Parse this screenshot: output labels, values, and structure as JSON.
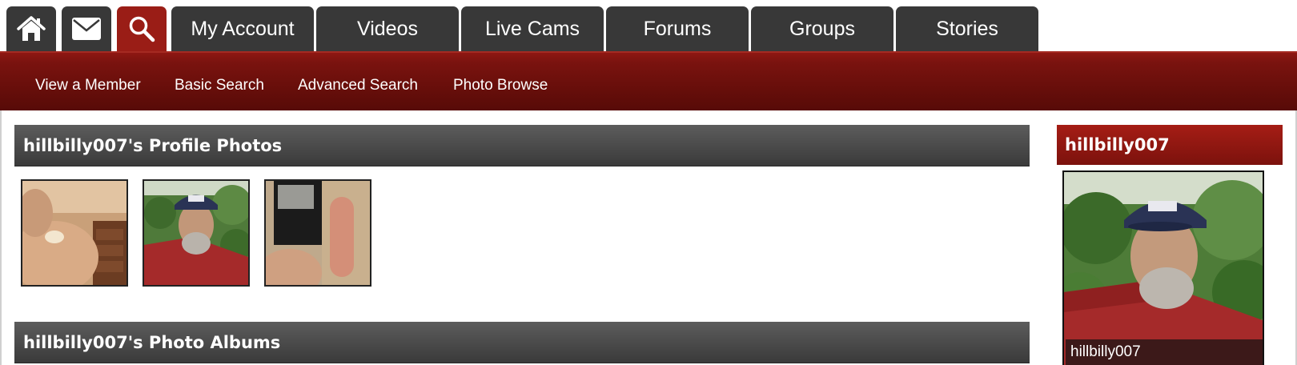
{
  "nav": {
    "icon_tabs": [
      {
        "icon": "home-icon",
        "active": false
      },
      {
        "icon": "mail-icon",
        "active": false
      },
      {
        "icon": "search-icon",
        "active": true
      }
    ],
    "tabs": [
      "My Account",
      "Videos",
      "Live Cams",
      "Forums",
      "Groups",
      "Stories"
    ]
  },
  "subnav": {
    "items": [
      "View a Member",
      "Basic Search",
      "Advanced Search",
      "Photo Browse"
    ]
  },
  "main": {
    "profile_photos_title": "hillbilly007's Profile Photos",
    "photo_albums_title": "hillbilly007's Photo Albums",
    "thumbnails": [
      "photo-thumbnail-1",
      "photo-thumbnail-2",
      "photo-thumbnail-3"
    ]
  },
  "sidebar": {
    "username": "hillbilly007",
    "caption": "hillbilly007"
  },
  "colors": {
    "tab_dark": "#383838",
    "tab_active": "#9a1d16",
    "subnav_red": "#6a0f0b",
    "section_grey": "#4a4a4a"
  }
}
